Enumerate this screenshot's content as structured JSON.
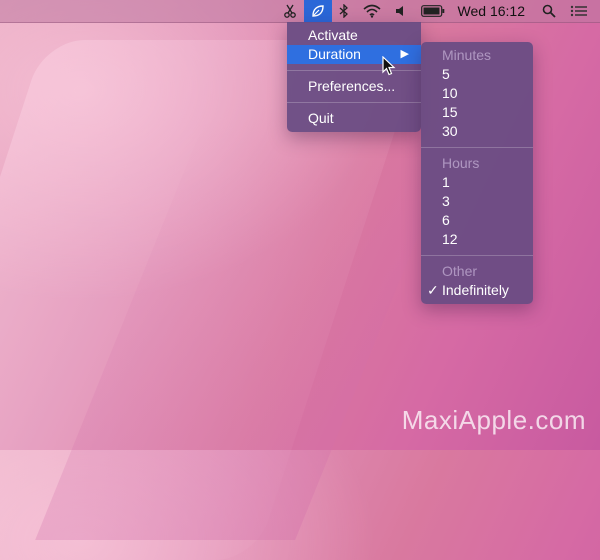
{
  "menubar": {
    "icons": [
      "scissors-icon",
      "app-leaf-icon",
      "bluetooth-icon",
      "wifi-icon",
      "volume-icon",
      "battery-icon",
      "search-icon",
      "list-icon"
    ],
    "clock": "Wed 16:12"
  },
  "main_menu": {
    "items": [
      "Activate",
      "Duration",
      "Preferences...",
      "Quit"
    ]
  },
  "sub_menu": {
    "minutes_header": "Minutes",
    "minutes": [
      "5",
      "10",
      "15",
      "30"
    ],
    "hours_header": "Hours",
    "hours": [
      "1",
      "3",
      "6",
      "12"
    ],
    "other_header": "Other",
    "indefinitely": "Indefinitely"
  },
  "watermark": "MaxiApple.com",
  "colors": {
    "highlight": "#2f6fe0",
    "menu_bg": "#674b82",
    "active_icon_bg": "#2a67d8"
  }
}
